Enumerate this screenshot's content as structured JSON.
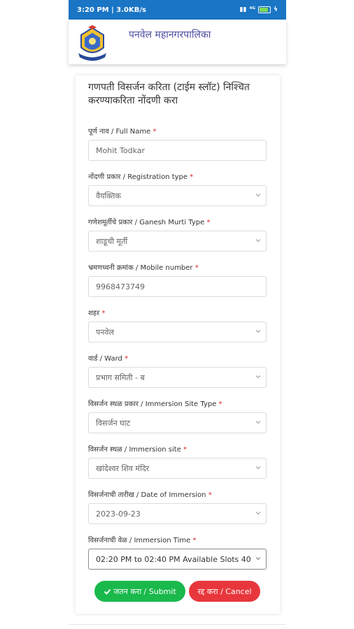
{
  "status_bar": {
    "time_speed": "3:20 PM | 3.0KB/s",
    "network": "⁴ᴳ",
    "battery_percent": 95
  },
  "app": {
    "title": "पनवेल महानगरपालिका"
  },
  "form": {
    "title": "गणपती विसर्जन करिता (टाईम स्लॉट) निश्चित करण्याकरिता नोंदणी करा",
    "fields": [
      {
        "label": "पूर्ण नाव / Full Name",
        "value": "Mohit Todkar"
      },
      {
        "label": "नोंदणी प्रकार / Registration type",
        "value": "वैयक्तिक"
      },
      {
        "label": "गणेशमूर्तीचे प्रकार / Ganesh Murti Type",
        "value": "शाडूची मूर्ती"
      },
      {
        "label": "भ्रमणध्वनी क्रमांक / Mobile number",
        "value": "9968473749"
      },
      {
        "label": "शहर",
        "value": "पनवेल"
      },
      {
        "label": "वार्ड / Ward",
        "value": "प्रभाग समिती - ब"
      },
      {
        "label": "विसर्जन स्थळ प्रकार / Immersion Site Type",
        "value": "विसर्जन घाट"
      },
      {
        "label": "विसर्जन स्थळ / Immersion site",
        "value": "खांदेश्वर शिव मंदिर"
      },
      {
        "label": "विसर्जनाची तारीख / Date of Immersion",
        "value": "2023-09-23"
      },
      {
        "label": "विसर्जनाची वेळ / Immersion Time",
        "value": "02:20 PM to 02:40 PM Available Slots 40"
      }
    ],
    "submit_label": "जतन करा / Submit",
    "cancel_label": "रद्द करा / Cancel"
  },
  "colors": {
    "status_bar": "#1a75c4",
    "submit": "#19b94b",
    "cancel": "#e8373c",
    "title": "#4a4aa0"
  }
}
